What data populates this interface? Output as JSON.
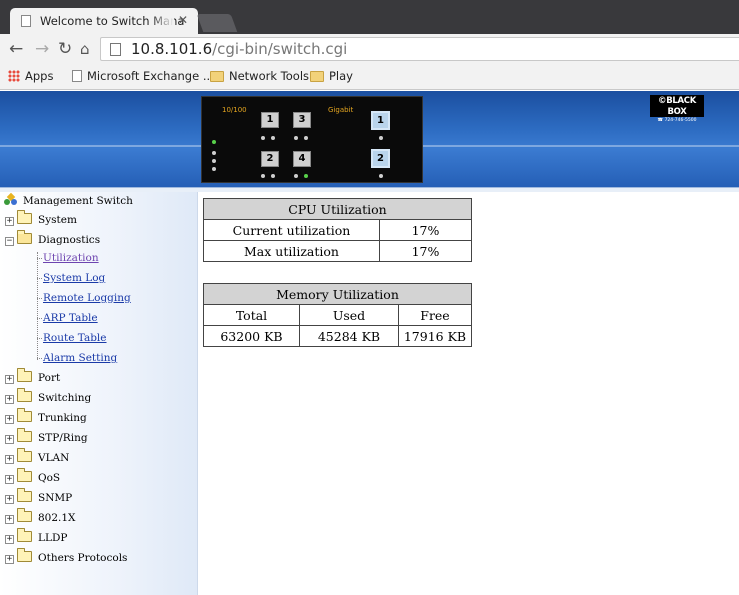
{
  "browser": {
    "tab_title": "Welcome to Switch Mana",
    "url_host": "10.8.101.6",
    "url_path": "/cgi-bin/switch.cgi",
    "bookmarks": [
      {
        "label": "Apps",
        "icon": "apps-icon"
      },
      {
        "label": "Microsoft Exchange ...",
        "icon": "page-icon"
      },
      {
        "label": "Network Tools",
        "icon": "folder-icon"
      },
      {
        "label": "Play",
        "icon": "folder-icon"
      }
    ]
  },
  "banner": {
    "label_10_100": "10/100",
    "label_gigabit": "Gigabit",
    "ports": [
      "1",
      "3",
      "2",
      "4"
    ],
    "sfp_ports": [
      "1",
      "2"
    ],
    "logo_brand": "©BLACK BOX",
    "logo_phone": "☎ 724-746-5500",
    "colors": {
      "banner": "#2d6cc2",
      "led_active": "#58d14a",
      "panel_label": "#e2a420"
    }
  },
  "sidebar": {
    "root": "Management Switch",
    "system": "System",
    "diagnostics": "Diagnostics",
    "diagnostics_children": [
      "Utilization",
      "System Log",
      "Remote Logging",
      "ARP Table",
      "Route Table",
      "Alarm Setting"
    ],
    "folders": [
      "Port",
      "Switching",
      "Trunking",
      "STP/Ring",
      "VLAN",
      "QoS",
      "SNMP",
      "802.1X",
      "LLDP",
      "Others Protocols"
    ]
  },
  "cpu": {
    "title": "CPU Utilization",
    "rows": [
      {
        "label": "Current utilization",
        "value": "17%"
      },
      {
        "label": "Max utilization",
        "value": "17%"
      }
    ]
  },
  "memory": {
    "title": "Memory Utilization",
    "headers": [
      "Total",
      "Used",
      "Free"
    ],
    "values": [
      "63200 KB",
      "45284 KB",
      "17916 KB"
    ]
  }
}
